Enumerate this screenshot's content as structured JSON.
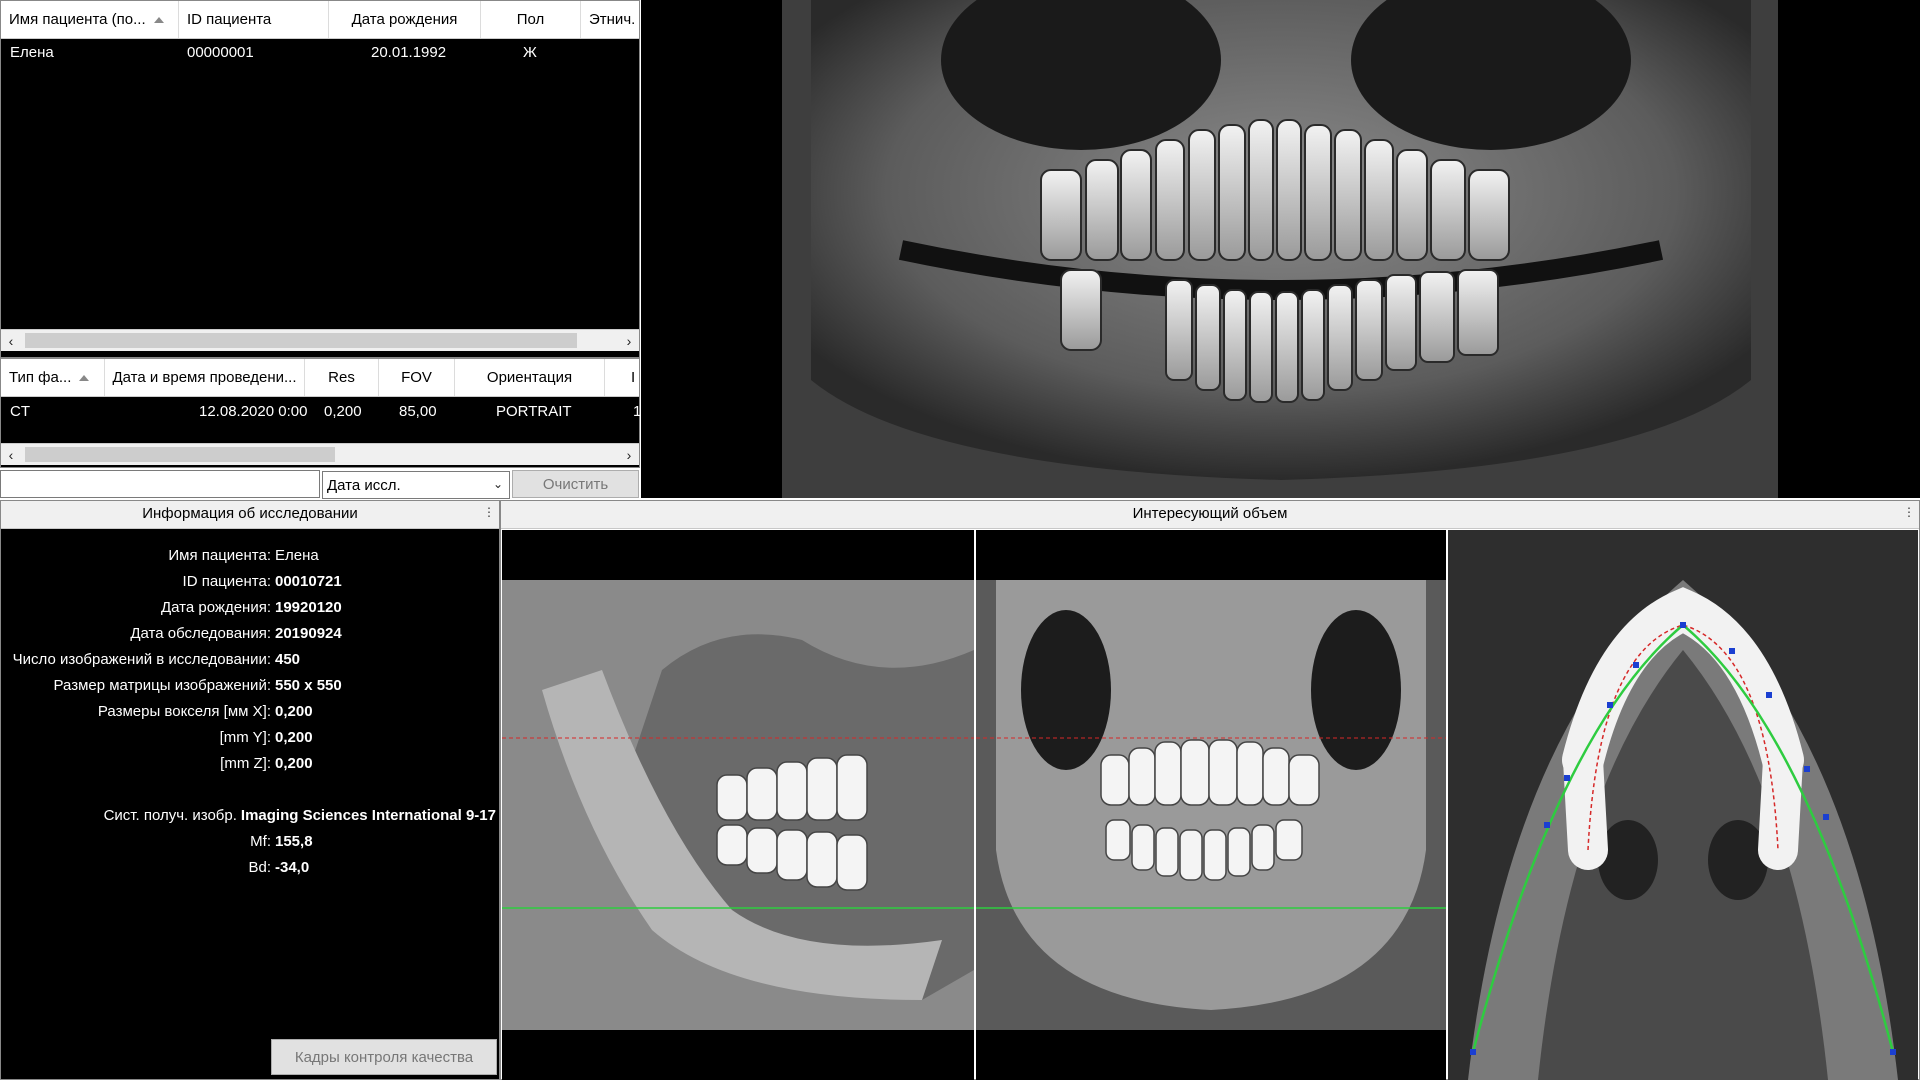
{
  "patients": {
    "columns": [
      "Имя пациента (по...",
      "ID пациента",
      "Дата рождения",
      "Пол",
      "Этнич."
    ],
    "rows": [
      [
        "Елена",
        "00000001",
        "20.01.1992",
        "Ж",
        ""
      ]
    ]
  },
  "studies": {
    "columns": [
      "Тип фа...",
      "Дата и время проведени...",
      "Res",
      "FOV",
      "Ориентация",
      "I"
    ],
    "rows": [
      [
        "CT",
        "12.08.2020 0:00",
        "0,200",
        "85,00",
        "PORTRAIT",
        "1"
      ]
    ]
  },
  "filter": {
    "search_value": "",
    "date_select": "Дата иссл.",
    "clear_label": "Очистить"
  },
  "info_panel": {
    "title": "Информация об исследовании",
    "rows": [
      {
        "label": "Имя пациента:",
        "value": "Елена"
      },
      {
        "label": "ID пациента:",
        "value": "00010721"
      },
      {
        "label": "Дата рождения:",
        "value": "19920120"
      },
      {
        "label": "Дата обследования:",
        "value": "20190924"
      },
      {
        "label": "Число изображений в исследовании:",
        "value": "450"
      },
      {
        "label": "Размер матрицы изображений:",
        "value": "550 x 550"
      },
      {
        "label": "Размеры вокселя [мм X]:",
        "value": "0,200"
      },
      {
        "label": "[mm Y]:",
        "value": "0,200"
      },
      {
        "label": "[mm Z]:",
        "value": "0,200"
      },
      {
        "label": "Сист. получ. изобр.",
        "value": "Imaging Sciences International 9-17"
      },
      {
        "label": "Mf:",
        "value": "155,8"
      },
      {
        "label": "Bd:",
        "value": "-34,0"
      }
    ],
    "qc_button": "Кадры контроля качества"
  },
  "volume_panel": {
    "title": "Интересующий объем"
  },
  "colors": {
    "accent_green": "#2ecc40",
    "guide_red": "#d62828",
    "point_blue": "#1b3fd1"
  }
}
